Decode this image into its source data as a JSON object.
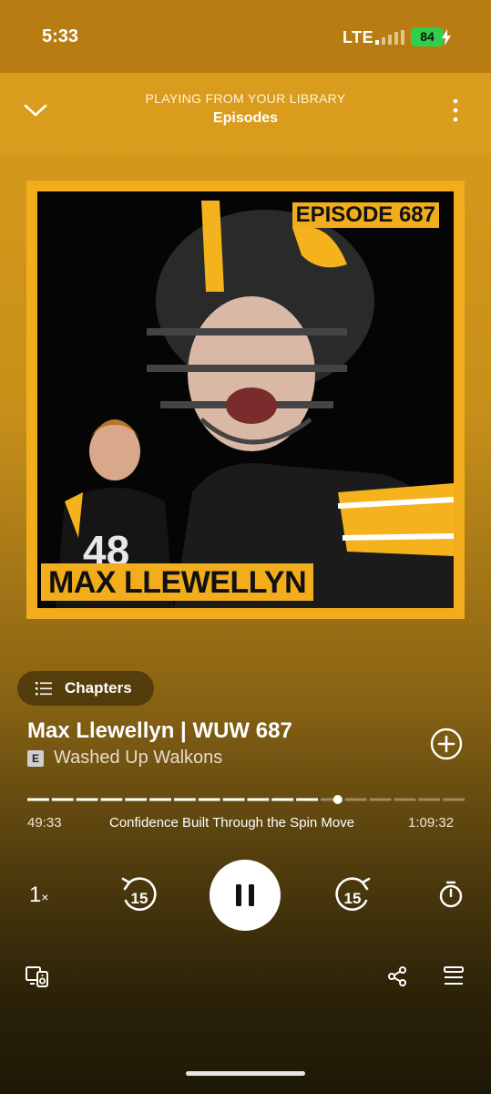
{
  "status_bar": {
    "time": "5:33",
    "network": "LTE",
    "battery": "84"
  },
  "header": {
    "playing_from": "PLAYING FROM YOUR LIBRARY",
    "context": "Episodes"
  },
  "artwork": {
    "episode_label": "EPISODE 687",
    "name_banner": "MAX LLEWELLYN"
  },
  "chapters_button": {
    "label": "Chapters"
  },
  "episode": {
    "title": "Max Llewellyn | WUW 687",
    "explicit_badge": "E",
    "show": "Washed Up Walkons"
  },
  "playback": {
    "elapsed": "49:33",
    "remaining": "1:09:32",
    "current_chapter": "Confidence Built Through the Spin Move",
    "progress_fraction": 0.71,
    "speed": "1",
    "speed_suffix": "×",
    "skip_back_seconds": "15",
    "skip_forward_seconds": "15"
  },
  "colors": {
    "header_bg": "#d99c1c",
    "art_accent": "#f2ad1c",
    "battery": "#2ecf4a"
  }
}
